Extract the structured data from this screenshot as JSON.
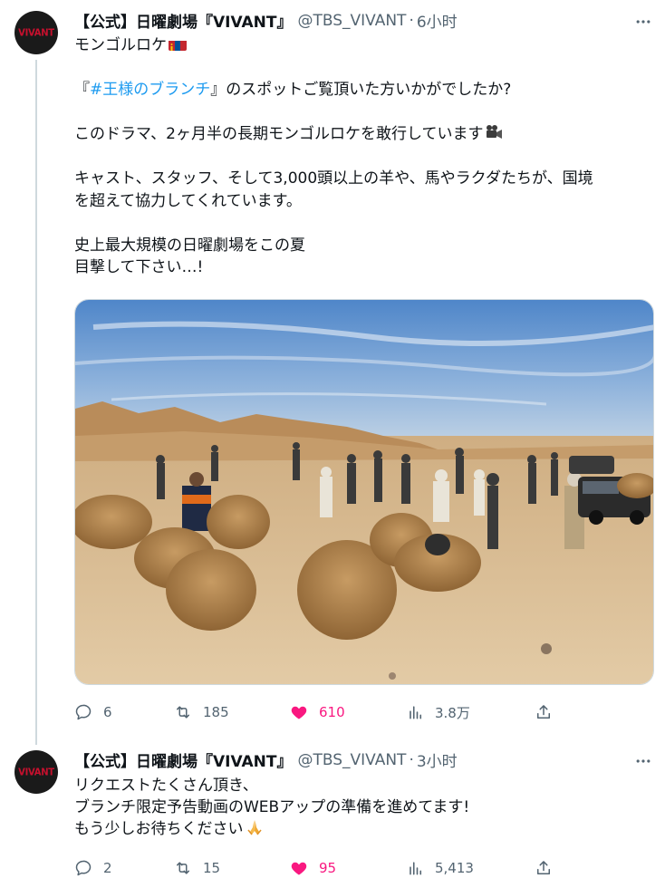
{
  "tweets": [
    {
      "avatar_text": "VIVANT",
      "name": "【公式】日曜劇場『VIVANT』",
      "handle": "@TBS_VIVANT",
      "separator": "·",
      "time": "6小时",
      "text": {
        "l1": "モンゴルロケ",
        "l2_pre": "『",
        "l2_link": "#王様のブランチ",
        "l2_post": "』のスポットご覧頂いた方いかがでしたか?",
        "l3": "このドラマ、2ヶ月半の長期モンゴルロケを敢行しています",
        "l4": "キャスト、スタッフ、そして3,000頭以上の羊や、馬やラクダたちが、国境",
        "l5": "を超えて協力してくれています。",
        "l6": "史上最大規模の日曜劇場をこの夏",
        "l7": "目撃して下さい…!"
      },
      "icons": {
        "flag": "mongolia-flag-icon",
        "camera": "movie-camera-icon"
      },
      "stats": {
        "replies": "6",
        "retweets": "185",
        "likes": "610",
        "views": "3.8万"
      },
      "liked": true
    },
    {
      "avatar_text": "VIVANT",
      "name": "【公式】日曜劇場『VIVANT』",
      "handle": "@TBS_VIVANT",
      "separator": "·",
      "time": "3小时",
      "text": {
        "l1": "リクエストたくさん頂き、",
        "l2": "ブランチ限定予告動画のWEBアップの準備を進めてます!",
        "l3": "もう少しお待ちください"
      },
      "icons": {
        "pray": "folded-hands-icon"
      },
      "stats": {
        "replies": "2",
        "retweets": "15",
        "likes": "95",
        "views": "5,413"
      },
      "liked": true
    }
  ],
  "colors": {
    "link": "#1d9bf0",
    "like": "#f91880",
    "muted": "#536471",
    "text": "#0f1419"
  }
}
